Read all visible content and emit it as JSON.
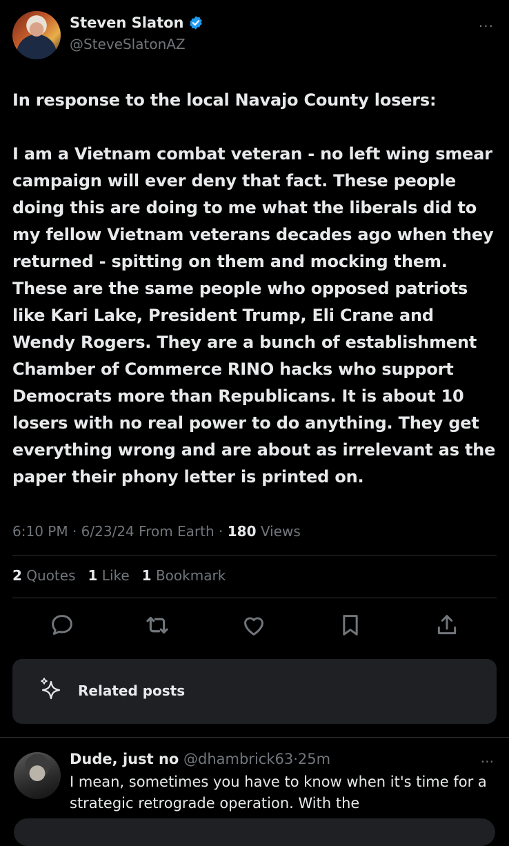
{
  "author": {
    "name": "Steven Slaton",
    "handle": "@SteveSlatonAZ",
    "more": "···"
  },
  "tweet": {
    "text": "In response to the local Navajo County losers:\n\nI am a Vietnam combat veteran - no left wing smear campaign will ever deny that fact. These people doing this are doing to me what the liberals did to my fellow Vietnam veterans decades ago when they returned - spitting on them and mocking them. These are the same people who opposed patriots like Kari Lake, President Trump, Eli Crane and Wendy Rogers. They are a bunch of establishment Chamber of Commerce RINO hacks who support Democrats more than Republicans. It is about 10 losers with no real power to do anything. They get everything wrong and are about as irrelevant as the paper their phony letter is printed on."
  },
  "meta": {
    "time": "6:10 PM",
    "date": "6/23/24",
    "source": "From Earth",
    "views_count": "180",
    "views_label": "Views",
    "sep": "·"
  },
  "stats": {
    "quotes_count": "2",
    "quotes_label": "Quotes",
    "likes_count": "1",
    "likes_label": "Like",
    "bookmarks_count": "1",
    "bookmarks_label": "Bookmark"
  },
  "actions": [
    "reply-icon",
    "retweet-icon",
    "like-icon",
    "bookmark-icon",
    "share-icon"
  ],
  "related": {
    "label": "Related posts"
  },
  "reply": {
    "name": "Dude, just no",
    "handle": "@dhambrick63",
    "sep": "·",
    "time": "25m",
    "more": "···",
    "text": "I mean, sometimes you have to know when it's time for a strategic retrograde operation. With the"
  },
  "colors": {
    "background": "#000000",
    "text": "#e7e9ea",
    "muted": "#71767b",
    "verified": "#1d9bf0",
    "card": "#1e2024",
    "divider": "#2f3336"
  }
}
